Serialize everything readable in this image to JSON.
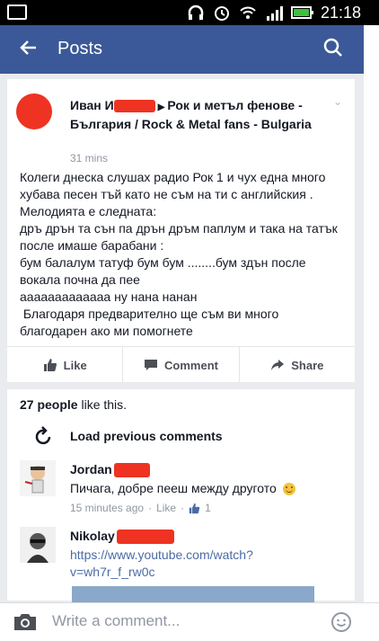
{
  "status_bar": {
    "time": "21:18"
  },
  "header": {
    "title": "Posts"
  },
  "post": {
    "author_name": "Иван И",
    "arrow": "▶",
    "group": "Рок и метъл фенове - България / Rock & Metal fans - Bulgaria",
    "time": "31 mins",
    "body": "Колеги днеска слушах радио Рок 1 и чух една много хубава песен тъй като не съм на ти с английския . Мелодията е следната:\nдръ дрън та сън па дрън дръм паплум и така на татък после имаше барабани :\nбум балалум татуф бум бум ........бум здън после вокала почна да пее\nааааааааааааа ну нана нанан\n Благодаря предварително ще съм ви много благодарен ако ми помогнете"
  },
  "actions": {
    "like": "Like",
    "comment": "Comment",
    "share": "Share"
  },
  "likes": {
    "count": "27 people",
    "suffix": " like this."
  },
  "load_previous": "Load previous comments",
  "comments": [
    {
      "name": "Jordan",
      "text": "Пичага, добре пееш между другото",
      "time": "15 minutes ago",
      "like": "Like",
      "like_count": "1"
    },
    {
      "name": "Nikolay",
      "text": "https://www.youtube.com/watch?v=wh7r_f_rw0c"
    }
  ],
  "composer": {
    "placeholder": "Write a comment..."
  },
  "colors": {
    "brand": "#3b5998",
    "redaction": "#e32222",
    "feed_bg": "#e9ebee"
  }
}
